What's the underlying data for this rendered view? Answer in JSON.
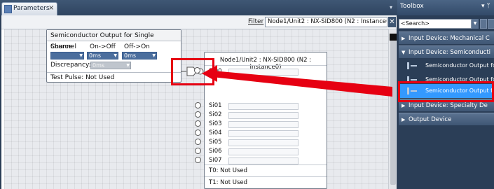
{
  "tab": {
    "label": "Parameters",
    "close": "×",
    "overflow": "▾"
  },
  "filter": {
    "label": "Filter",
    "value": "Node1/Unit2 : NX-SID800 (N2 : Instance0)",
    "clear": "✕"
  },
  "fb_block": {
    "title": "Semiconductor Output for Single Channel",
    "headers": [
      "Source",
      "On->Off",
      "Off->On"
    ],
    "onoff_value": "0ms",
    "offon_value": "0ms",
    "discrepancy_label": "Discrepancy:",
    "discrepancy_value": "0ms",
    "test_pulse": "Test Pulse: Not Used"
  },
  "device_block": {
    "title": "Node1/Unit2 : NX-SID800 (N2 : Instance0)",
    "ports": [
      "Si00",
      "Si01",
      "Si02",
      "Si03",
      "Si04",
      "Si05",
      "Si06",
      "Si07"
    ],
    "t0": "T0: Not Used",
    "t1": "T1: Not Used"
  },
  "toolbox": {
    "title": "Toolbox",
    "pin": "▾ ᛘ",
    "search_placeholder": "<Search>",
    "categories": [
      {
        "label": "Input Device: Mechanical C",
        "expanded": false
      },
      {
        "label": "Input Device: Semiconducti",
        "expanded": true
      },
      {
        "label": "Input Device: Specialty De",
        "expanded": false
      },
      {
        "label": "Output Device",
        "expanded": false
      }
    ],
    "items": [
      "Semiconductor Output fo",
      "Semiconductor Output fo",
      "Semiconductor Output fo"
    ],
    "selected_index": 2
  },
  "colors": {
    "highlight": "#e60012",
    "selection": "#3399ff",
    "panel": "#2b3e57"
  }
}
